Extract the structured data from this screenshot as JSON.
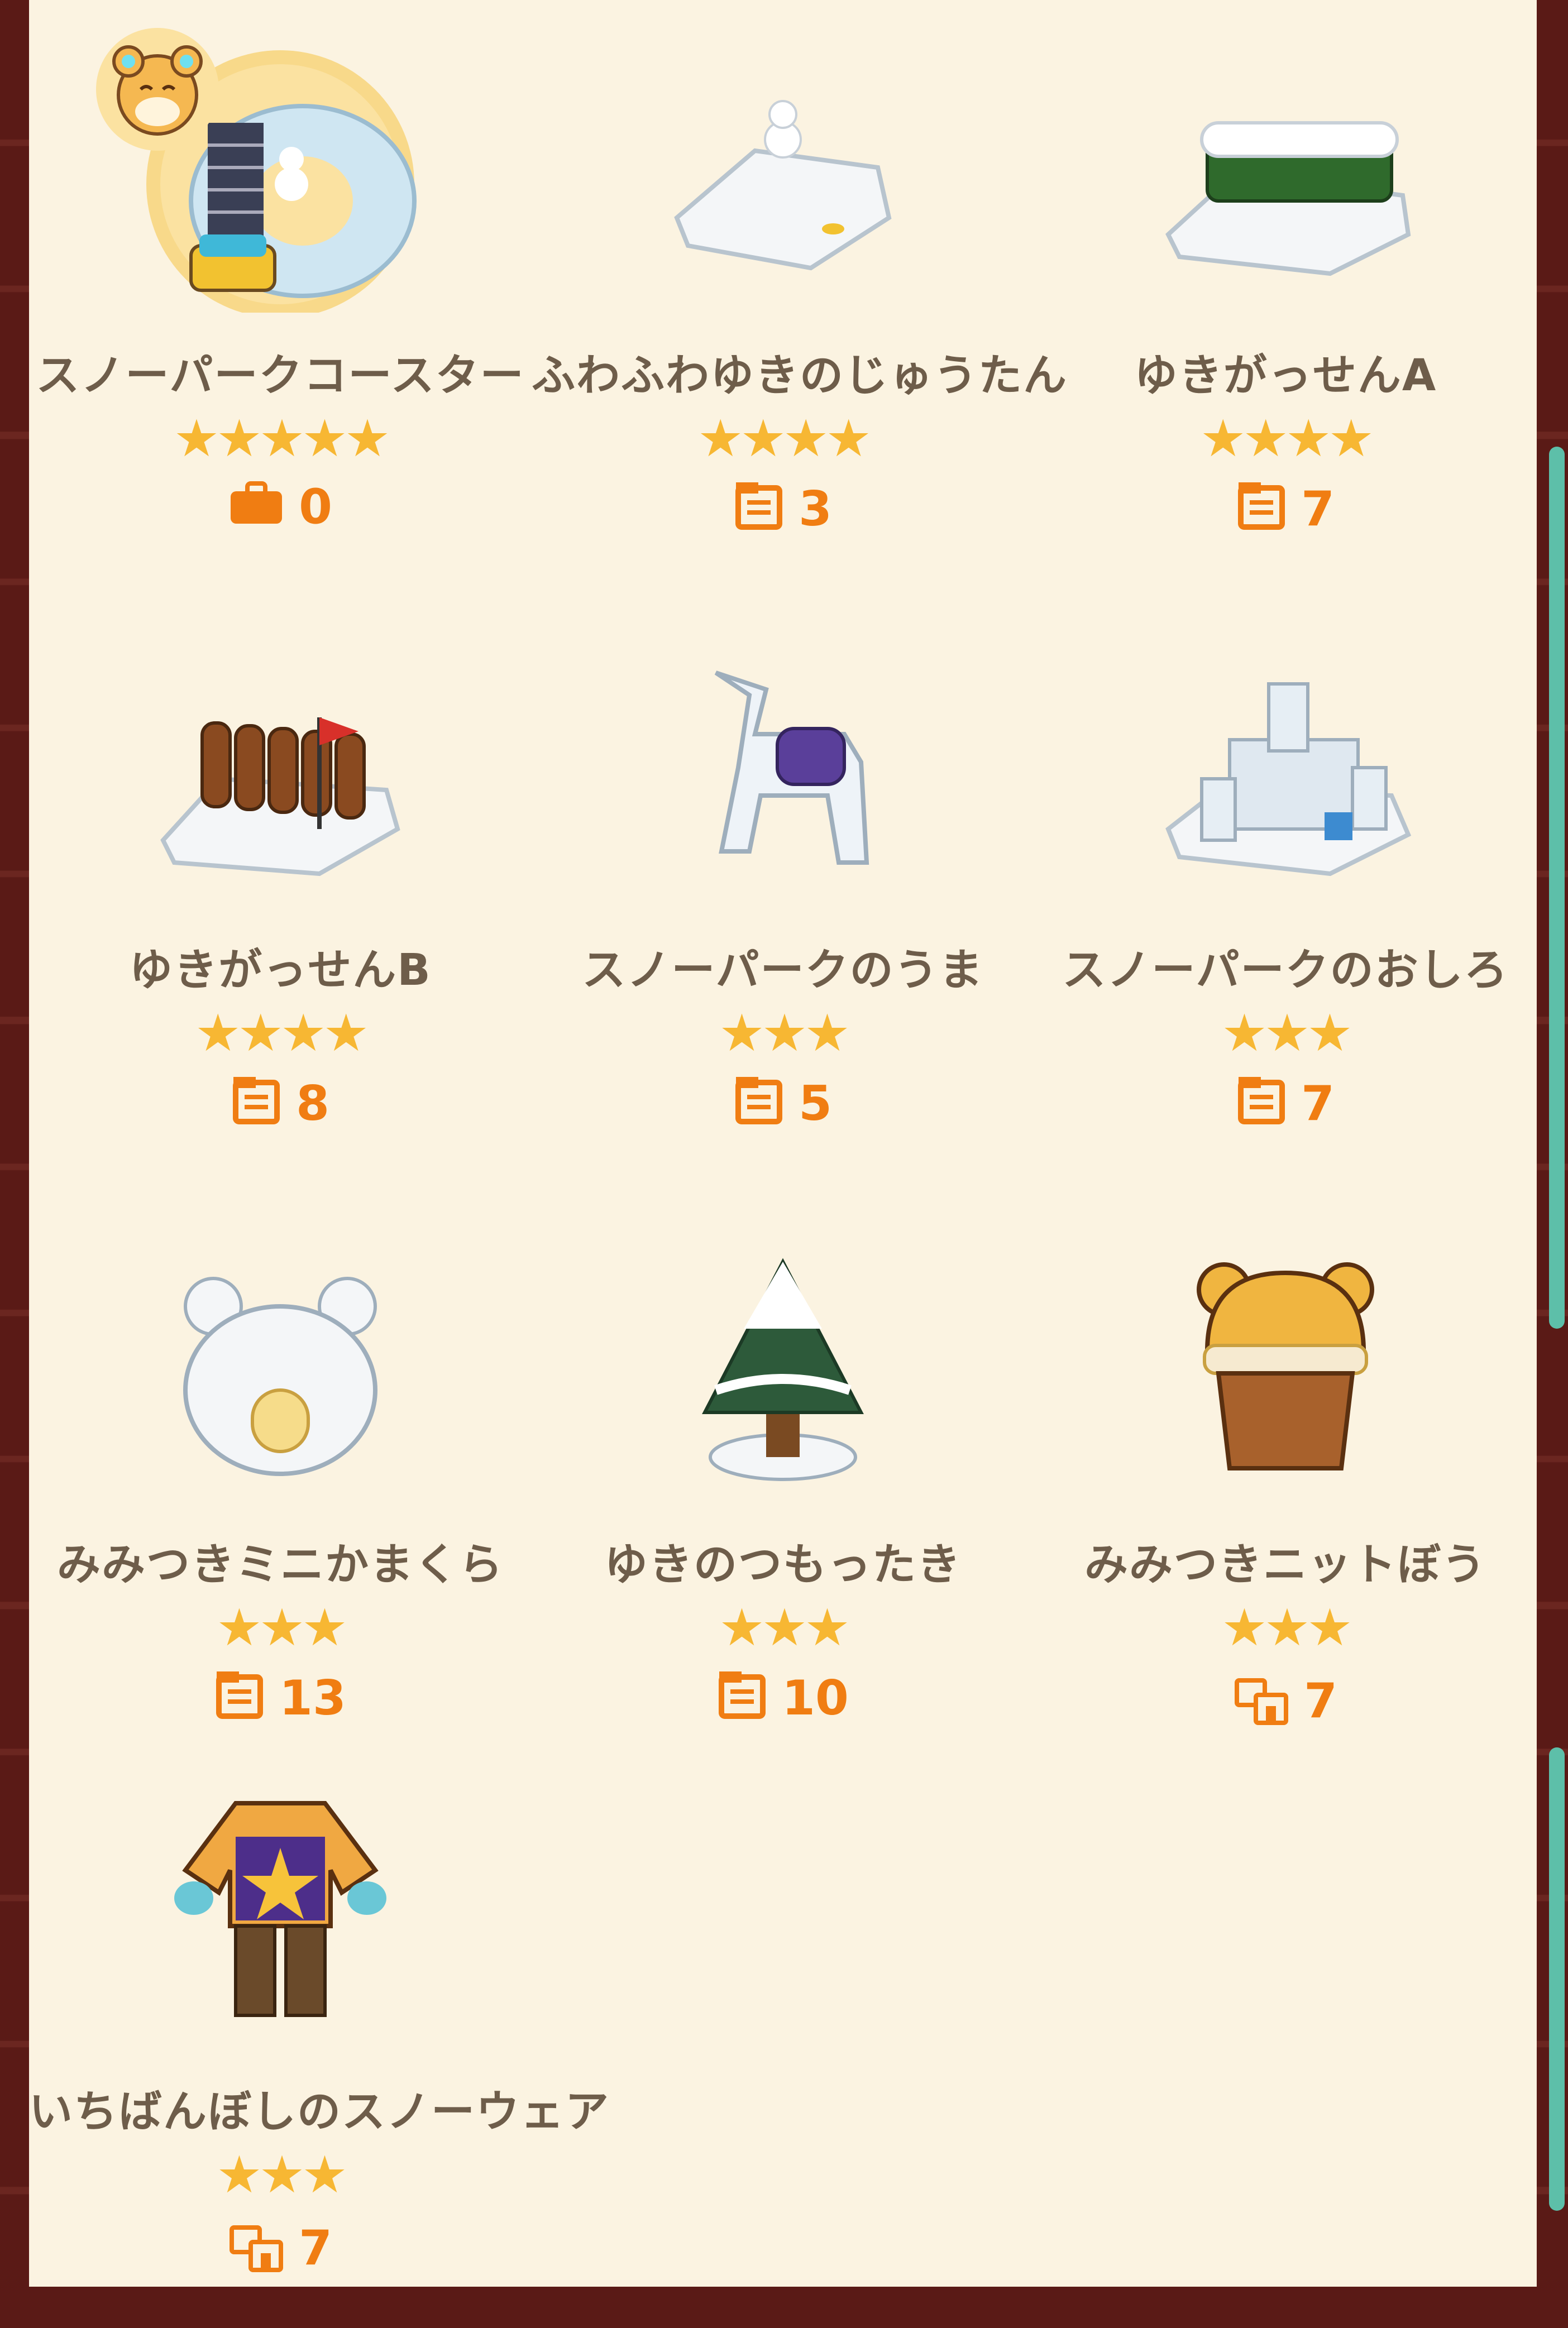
{
  "items": [
    {
      "name": "スノーパークコースター",
      "stars": "★★★★★",
      "count": "0",
      "count_icon": "bag-icon"
    },
    {
      "name": "ふわふわゆきのじゅうたん",
      "stars": "★★★★",
      "count": "3",
      "count_icon": "material-icon"
    },
    {
      "name": "ゆきがっせんA",
      "stars": "★★★★",
      "count": "7",
      "count_icon": "material-icon"
    },
    {
      "name": "ゆきがっせんB",
      "stars": "★★★★",
      "count": "8",
      "count_icon": "material-icon"
    },
    {
      "name": "スノーパークのうま",
      "stars": "★★★",
      "count": "5",
      "count_icon": "material-icon"
    },
    {
      "name": "スノーパークのおしろ",
      "stars": "★★★",
      "count": "7",
      "count_icon": "material-icon"
    },
    {
      "name": "みみつきミニかまくら",
      "stars": "★★★",
      "count": "13",
      "count_icon": "material-icon"
    },
    {
      "name": "ゆきのつもったき",
      "stars": "★★★",
      "count": "10",
      "count_icon": "material-icon"
    },
    {
      "name": "みみつきニットぼう",
      "stars": "★★★",
      "count": "7",
      "count_icon": "clothing-shop-icon"
    },
    {
      "name": "いちばんぼしのスノーウェア",
      "stars": "★★★",
      "count": "7",
      "count_icon": "clothing-shop-icon"
    }
  ],
  "colors": {
    "panel_bg": "#fbf3e1",
    "star": "#f7b733",
    "count": "#f07d12",
    "name_text": "#6e5d4a",
    "scrollbar": "#5dbfa9",
    "frame": "#5a1a16"
  }
}
